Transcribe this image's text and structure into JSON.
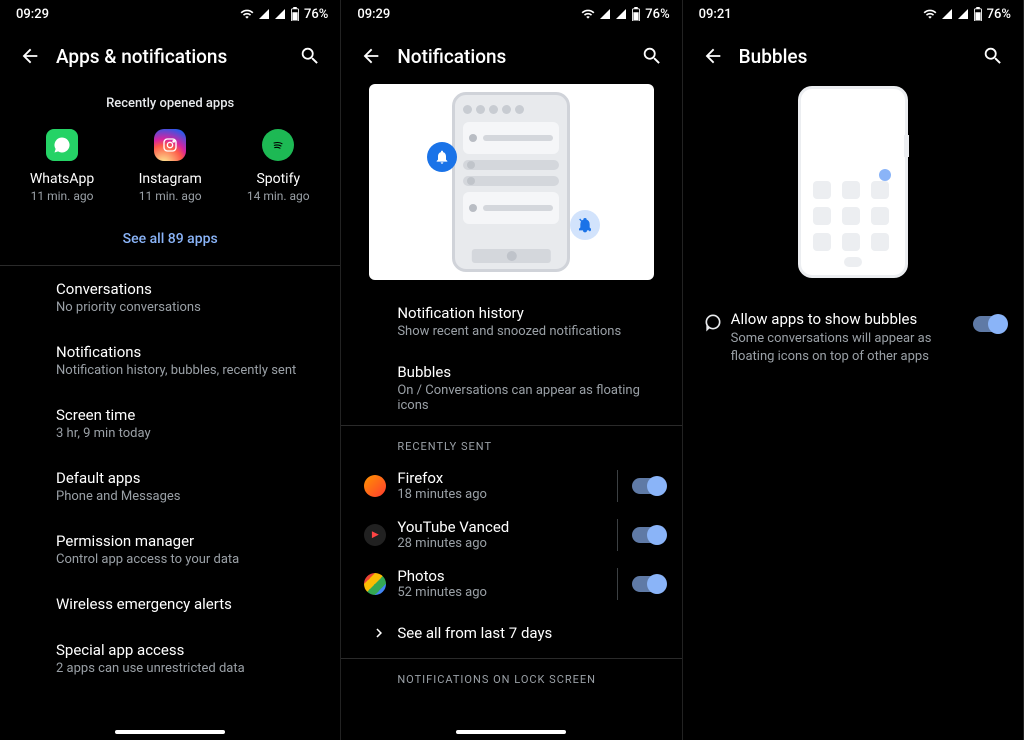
{
  "screens": [
    {
      "status": {
        "time": "09:29",
        "battery": "76%"
      },
      "title": "Apps & notifications",
      "recent_header": "Recently opened apps",
      "recent_apps": [
        {
          "name": "WhatsApp",
          "time": "11 min. ago"
        },
        {
          "name": "Instagram",
          "time": "11 min. ago"
        },
        {
          "name": "Spotify",
          "time": "14 min. ago"
        }
      ],
      "see_all": "See all 89 apps",
      "settings": [
        {
          "title": "Conversations",
          "subtitle": "No priority conversations"
        },
        {
          "title": "Notifications",
          "subtitle": "Notification history, bubbles, recently sent"
        },
        {
          "title": "Screen time",
          "subtitle": "3 hr, 9 min today"
        },
        {
          "title": "Default apps",
          "subtitle": "Phone and Messages"
        },
        {
          "title": "Permission manager",
          "subtitle": "Control app access to your data"
        },
        {
          "title": "Wireless emergency alerts",
          "subtitle": ""
        },
        {
          "title": "Special app access",
          "subtitle": "2 apps can use unrestricted data"
        }
      ]
    },
    {
      "status": {
        "time": "09:29",
        "battery": "76%"
      },
      "title": "Notifications",
      "top_settings": [
        {
          "title": "Notification history",
          "subtitle": "Show recent and snoozed notifications"
        },
        {
          "title": "Bubbles",
          "subtitle": "On / Conversations can appear as floating icons"
        }
      ],
      "recently_sent_label": "RECENTLY SENT",
      "recent_notifs": [
        {
          "name": "Firefox",
          "time": "18 minutes ago",
          "on": true
        },
        {
          "name": "YouTube Vanced",
          "time": "28 minutes ago",
          "on": true
        },
        {
          "name": "Photos",
          "time": "52 minutes ago",
          "on": true
        }
      ],
      "see_all_days": "See all from last 7 days",
      "lock_section_label": "NOTIFICATIONS ON LOCK SCREEN"
    },
    {
      "status": {
        "time": "09:21",
        "battery": "76%"
      },
      "title": "Bubbles",
      "allow": {
        "title": "Allow apps to show bubbles",
        "subtitle": "Some conversations will appear as floating icons on top of other apps",
        "on": true
      }
    }
  ]
}
